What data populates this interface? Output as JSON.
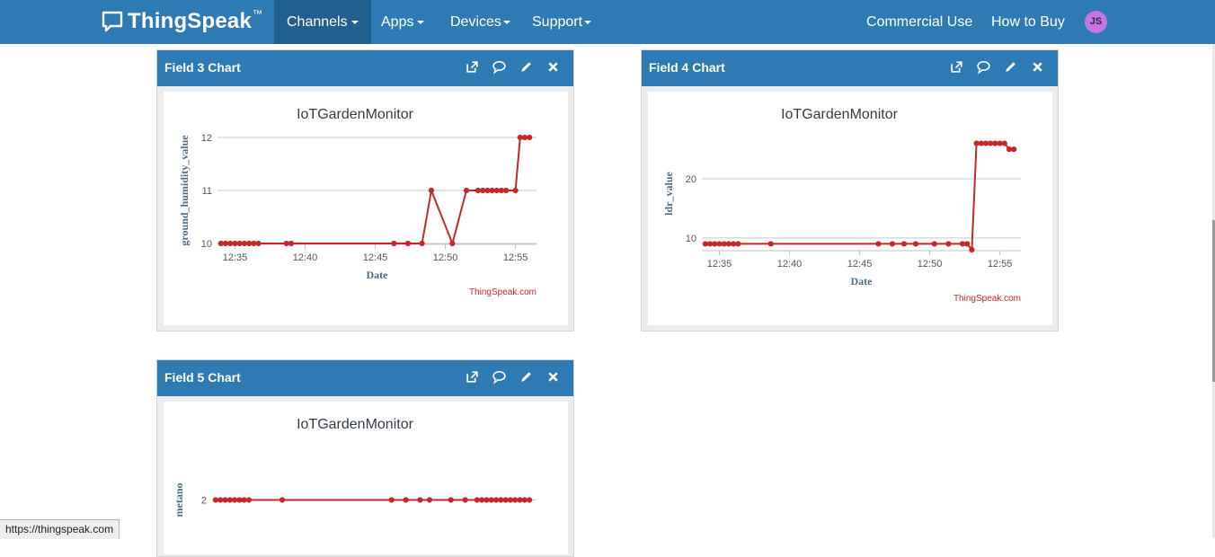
{
  "navbar": {
    "brand": "ThingSpeak",
    "brand_mark": "™",
    "items": [
      {
        "label": "Channels",
        "active": true
      },
      {
        "label": "Apps"
      },
      {
        "label": "Devices"
      },
      {
        "label": "Support"
      }
    ],
    "right": {
      "commercial": "Commercial Use",
      "buy": "How to Buy",
      "avatar": "JS"
    },
    "colors": {
      "bar": "#2e7bb4",
      "active": "#215f8e",
      "avatar": "#c377e0"
    }
  },
  "panels": [
    {
      "title": "Field 3 Chart",
      "tools": [
        "external-link-icon",
        "comment-icon",
        "pencil-icon",
        "close-icon"
      ]
    },
    {
      "title": "Field 4 Chart",
      "tools": [
        "external-link-icon",
        "comment-icon",
        "pencil-icon",
        "close-icon"
      ]
    },
    {
      "title": "Field 5 Chart",
      "tools": [
        "external-link-icon",
        "comment-icon",
        "pencil-icon",
        "close-icon"
      ]
    }
  ],
  "status_url": "https://thingspeak.com",
  "chart_data": [
    {
      "type": "line",
      "title": "IoTGardenMonitor",
      "xlabel": "Date",
      "ylabel": "ground_humidity_value",
      "credit": "ThingSpeak.com",
      "xticks": [
        "12:35",
        "12:40",
        "12:45",
        "12:50",
        "12:55"
      ],
      "yticks": [
        10,
        11,
        12
      ],
      "xlim": [
        "12:33:45",
        "12:56:30"
      ],
      "ylim": [
        10,
        12
      ],
      "color": "#c62828",
      "series": [
        {
          "x": [
            "12:34:00",
            "12:34:20",
            "12:34:40",
            "12:35:00",
            "12:35:20",
            "12:35:40",
            "12:36:00",
            "12:36:20",
            "12:36:40",
            "12:38:40",
            "12:39:00",
            "12:46:20",
            "12:47:20",
            "12:48:20",
            "12:49:00",
            "12:50:30",
            "12:51:30",
            "12:52:20",
            "12:52:40",
            "12:53:00",
            "12:53:20",
            "12:53:40",
            "12:54:00",
            "12:54:20",
            "12:55:00",
            "12:55:20",
            "12:55:40",
            "12:56:00"
          ],
          "y": [
            10,
            10,
            10,
            10,
            10,
            10,
            10,
            10,
            10,
            10,
            10,
            10,
            10,
            10,
            11,
            10,
            11,
            11,
            11,
            11,
            11,
            11,
            11,
            11,
            11,
            12,
            12,
            12
          ]
        }
      ]
    },
    {
      "type": "line",
      "title": "IoTGardenMonitor",
      "xlabel": "Date",
      "ylabel": "ldr_value",
      "credit": "ThingSpeak.com",
      "xticks": [
        "12:35",
        "12:40",
        "12:45",
        "12:50",
        "12:55"
      ],
      "yticks": [
        10,
        20
      ],
      "xlim": [
        "12:33:45",
        "12:56:30"
      ],
      "ylim": [
        8,
        27
      ],
      "color": "#c62828",
      "series": [
        {
          "x": [
            "12:34:00",
            "12:34:20",
            "12:34:40",
            "12:35:00",
            "12:35:20",
            "12:35:40",
            "12:36:00",
            "12:36:20",
            "12:38:40",
            "12:46:20",
            "12:47:20",
            "12:48:10",
            "12:49:00",
            "12:50:20",
            "12:51:20",
            "12:52:20",
            "12:52:40",
            "12:53:00",
            "12:53:20",
            "12:53:40",
            "12:54:00",
            "12:54:20",
            "12:54:40",
            "12:55:00",
            "12:55:20",
            "12:55:40",
            "12:56:00"
          ],
          "y": [
            9,
            9,
            9,
            9,
            9,
            9,
            9,
            9,
            9,
            9,
            9,
            9,
            9,
            9,
            9,
            9,
            9,
            8,
            26,
            26,
            26,
            26,
            26,
            26,
            26,
            25,
            25
          ]
        }
      ]
    },
    {
      "type": "line",
      "title": "IoTGardenMonitor",
      "xlabel": "",
      "ylabel": "metano",
      "credit": "",
      "xticks": [],
      "yticks": [
        2
      ],
      "xlim": [
        "12:33:45",
        "12:56:30"
      ],
      "ylim": [
        1,
        3
      ],
      "color": "#c62828",
      "series": [
        {
          "x": [
            "12:34:00",
            "12:34:20",
            "12:34:40",
            "12:35:00",
            "12:35:20",
            "12:35:40",
            "12:36:00",
            "12:36:20",
            "12:38:40",
            "12:46:20",
            "12:47:20",
            "12:48:20",
            "12:49:00",
            "12:50:30",
            "12:51:30",
            "12:52:20",
            "12:52:40",
            "12:53:00",
            "12:53:20",
            "12:53:40",
            "12:54:00",
            "12:54:20",
            "12:54:40",
            "12:55:00",
            "12:55:20",
            "12:55:40",
            "12:56:00"
          ],
          "y": [
            2,
            2,
            2,
            2,
            2,
            2,
            2,
            2,
            2,
            2,
            2,
            2,
            2,
            2,
            2,
            2,
            2,
            2,
            2,
            2,
            2,
            2,
            2,
            2,
            2,
            2,
            2
          ]
        }
      ]
    }
  ]
}
